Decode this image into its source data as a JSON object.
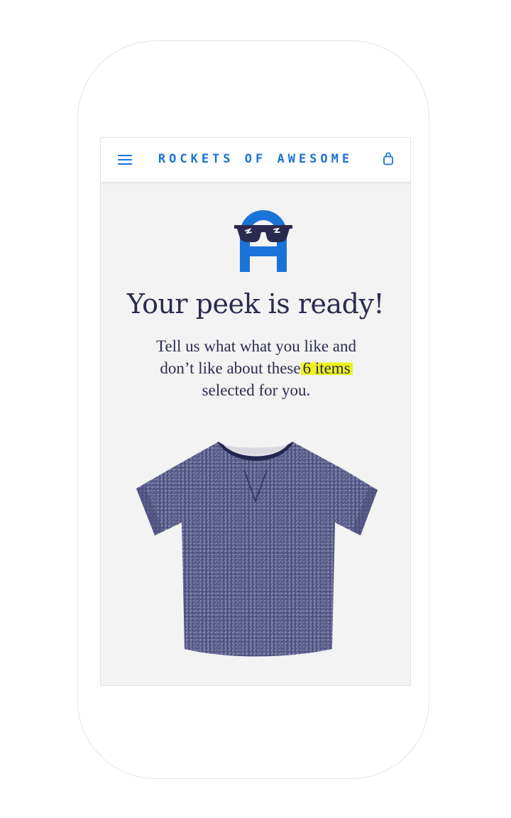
{
  "header": {
    "brand": "ROCKETS OF AWESOME",
    "menu_icon": "hamburger-menu-icon",
    "cart_icon": "shopping-bag-icon"
  },
  "hero": {
    "logo": "rockets-of-awesome-logo-with-sunglasses",
    "title": "Your peek is ready!",
    "subtitle_part1": "Tell us what what you like and don’t like about these",
    "subtitle_highlight": "6 items",
    "subtitle_part2": "selected for you."
  },
  "product": {
    "image": "heather-navy-t-shirt"
  },
  "colors": {
    "brand_blue": "#1a73d9",
    "text_navy": "#2c2b52",
    "highlight_yellow": "#eef31f",
    "screen_bg": "#f3f3f3"
  }
}
